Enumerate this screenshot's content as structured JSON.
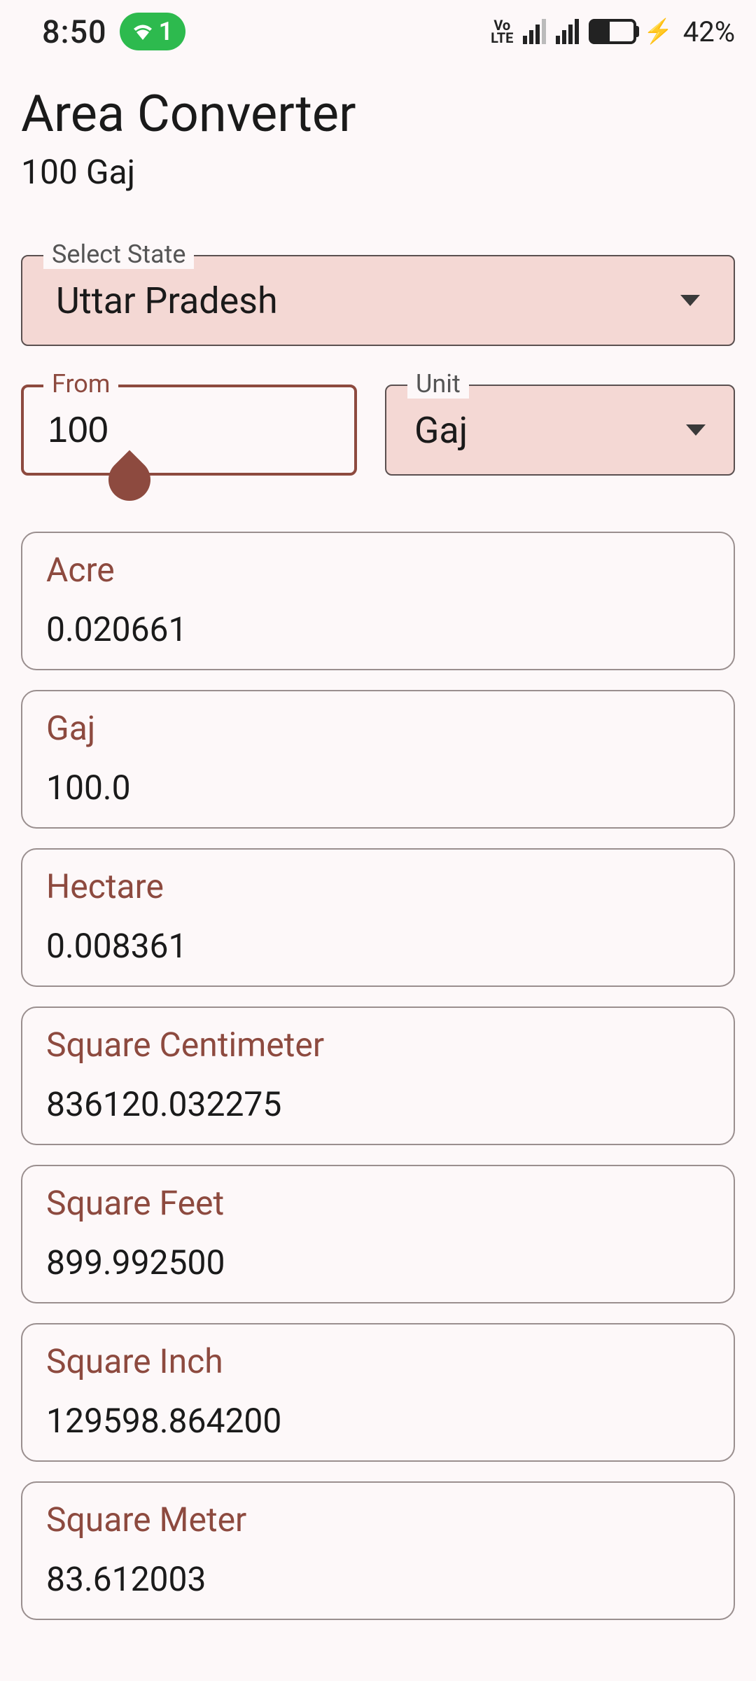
{
  "statusbar": {
    "time": "8:50",
    "wifi_badge": "1",
    "volte_top": "Vo",
    "volte_bottom": "LTE",
    "battery_pct": "42%"
  },
  "header": {
    "title": "Area Converter",
    "subtitle": "100 Gaj"
  },
  "state_selector": {
    "label": "Select State",
    "value": "Uttar Pradesh"
  },
  "from_input": {
    "label": "From",
    "value": "100"
  },
  "unit_selector": {
    "label": "Unit",
    "value": "Gaj"
  },
  "results": [
    {
      "label": "Acre",
      "value": "0.020661"
    },
    {
      "label": "Gaj",
      "value": "100.0"
    },
    {
      "label": "Hectare",
      "value": "0.008361"
    },
    {
      "label": "Square Centimeter",
      "value": "836120.032275"
    },
    {
      "label": "Square Feet",
      "value": "899.992500"
    },
    {
      "label": "Square Inch",
      "value": "129598.864200"
    },
    {
      "label": "Square Meter",
      "value": "83.612003"
    }
  ]
}
